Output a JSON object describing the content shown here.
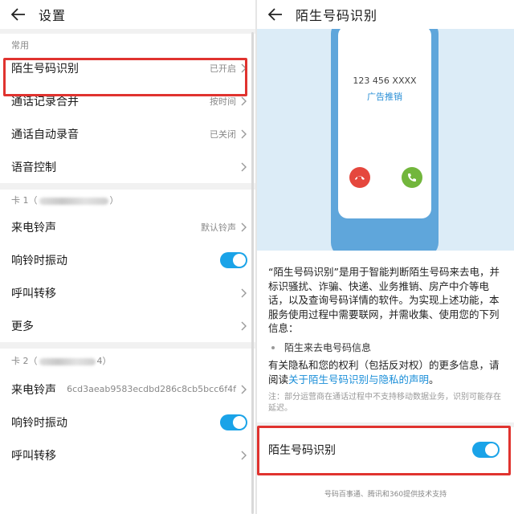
{
  "left": {
    "title": "设置",
    "section_common": "常用",
    "common_items": [
      {
        "label": "陌生号码识别",
        "value": "已开启"
      },
      {
        "label": "通话记录合并",
        "value": "按时间"
      },
      {
        "label": "通话自动录音",
        "value": "已关闭"
      },
      {
        "label": "语音控制",
        "value": ""
      }
    ],
    "sim1": {
      "header_prefix": "卡 1（",
      "header_suffix": "）",
      "items": [
        {
          "label": "来电铃声",
          "value": "默认铃声"
        },
        {
          "label": "响铃时振动",
          "toggle": true
        },
        {
          "label": "呼叫转移"
        },
        {
          "label": "更多"
        }
      ]
    },
    "sim2": {
      "header_prefix": "卡 2（",
      "header_suffix": "4）",
      "items": [
        {
          "label": "来电铃声",
          "value": "6cd3aeab9583ecdbd286c8cb5bcc6f4f"
        },
        {
          "label": "响铃时振动",
          "toggle": true
        },
        {
          "label": "呼叫转移"
        }
      ]
    }
  },
  "right": {
    "title": "陌生号码识别",
    "phone_number": "123 456 XXXX",
    "phone_tag": "广告推销",
    "description": "“陌生号码识别”是用于智能判断陌生号码来去电，并标识骚扰、诈骗、快递、业务推销、房产中介等电话，以及查询号码详情的软件。为实现上述功能，本服务使用过程中需要联网，并需收集、使用您的下列信息：",
    "bullet": "陌生来去电号码信息",
    "privacy_prefix": "有关隐私和您的权利（包括反对权）的更多信息，请阅读",
    "privacy_link": "关于陌生号码识别与隐私的声明",
    "privacy_suffix": "。",
    "note": "注：部分运营商在通话过程中不支持移动数据业务，识别可能存在延迟。",
    "toggle_label": "陌生号码识别",
    "toggle_on": true,
    "footer": "号码百事通、腾讯和360提供技术支持"
  },
  "colors": {
    "accent": "#1aa3e8",
    "highlight": "#e0332f",
    "link": "#1a8ed8",
    "hero_bg": "#dcecf7",
    "phone_body": "#5fa6db",
    "decline": "#e5473d",
    "accept": "#72b63c"
  },
  "icons": [
    "back-arrow-icon",
    "chevron-right-icon",
    "phone-decline-icon",
    "phone-accept-icon"
  ]
}
